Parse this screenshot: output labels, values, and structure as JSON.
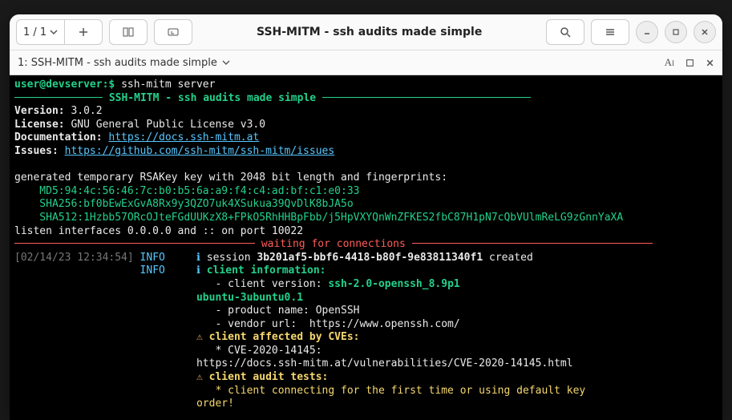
{
  "window": {
    "title": "SSH-MITM - ssh audits made simple",
    "pager": "1 / 1",
    "tab_label": "1: SSH-MITM - ssh audits made simple"
  },
  "term": {
    "prompt_user": "user@devserver:$ ",
    "prompt_cmd": "ssh-mitm server",
    "banner": " SSH-MITM - ssh audits made simple ",
    "version_label": "Version:",
    "version": " 3.0.2",
    "license_label": "License:",
    "license": " GNU General Public License v3.0",
    "doc_label": "Documentation:",
    "doc_url": "https://docs.ssh-mitm.at",
    "issues_label": "Issues:",
    "issues_url": "https://github.com/ssh-mitm/ssh-mitm/issues",
    "gen_line": "generated temporary RSAKey key with 2048 bit length and fingerprints:",
    "fp_md5": "    MD5:94:4c:56:46:7c:b0:b5:6a:a9:f4:c4:ad:bf:c1:e0:33",
    "fp_sha256": "    SHA256:bf0bEwExGvA8Rx9y3QZO7uk4XSukua39QvDlK8bJA5o",
    "fp_sha512": "    SHA512:1Hzbb57ORcOJteFGdUUKzX8+FPkO5RhHHBpFbb/j5HpVXYQnWnZFKES2fbC87H1pN7cQbVUlmReLG9zGnnYaXA",
    "listen": "listen interfaces 0.0.0.0 and :: on port 10022",
    "waiting": " waiting for connections ",
    "ts": "[02/14/23 12:34:54]",
    "info": "INFO",
    "session_pre": "session ",
    "session_id": "3b201af5-bbf6-4418-b80f-9e83811340f1",
    "session_post": " created",
    "client_info_hdr": "client information:",
    "cv_label": "   - client version: ",
    "cv_value": "ssh-2.0-openssh_8.9p1",
    "cv_ubuntu": "ubuntu-3ubuntu0.1",
    "prod_line": "   - product name: OpenSSH",
    "vendor_line": "   - vendor url:  https://www.openssh.com/",
    "cve_hdr": "client affected by CVEs:",
    "cve_item": "   * CVE-2020-14145:",
    "cve_url": "https://docs.ssh-mitm.at/vulnerabilities/CVE-2020-14145.html",
    "audit_hdr": "client audit tests:",
    "audit_item": "   * client connecting for the first time or using default key",
    "audit_order": "order!",
    "glyph_i": "ℹ",
    "glyph_warn": "⚠"
  }
}
